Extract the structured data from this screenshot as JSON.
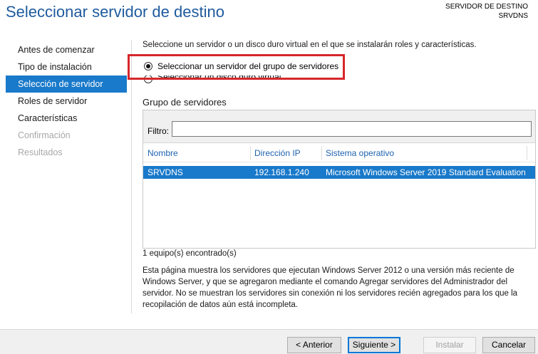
{
  "header": {
    "title": "Seleccionar servidor de destino",
    "dest_label": "SERVIDOR DE DESTINO",
    "dest_server": "SRVDNS"
  },
  "nav": {
    "items": [
      {
        "label": "Antes de comenzar",
        "state": "normal"
      },
      {
        "label": "Tipo de instalación",
        "state": "normal"
      },
      {
        "label": "Selección de servidor",
        "state": "active"
      },
      {
        "label": "Roles de servidor",
        "state": "normal"
      },
      {
        "label": "Características",
        "state": "normal"
      },
      {
        "label": "Confirmación",
        "state": "disabled"
      },
      {
        "label": "Resultados",
        "state": "disabled"
      }
    ]
  },
  "main": {
    "intro": "Seleccione un servidor o un disco duro virtual en el que se instalarán roles y características.",
    "option_pool": "Seleccionar un servidor del grupo de servidores",
    "option_vhd": "Seleccionar un disco duro virtual",
    "group_title": "Grupo de servidores",
    "filter_label": "Filtro:",
    "filter_value": "",
    "columns": [
      "Nombre",
      "Dirección IP",
      "Sistema operativo"
    ],
    "rows": [
      {
        "name": "SRVDNS",
        "ip": "192.168.1.240",
        "os": "Microsoft Windows Server 2019 Standard Evaluation"
      }
    ],
    "count": "1 equipo(s) encontrado(s)",
    "description": "Esta página muestra los servidores que ejecutan Windows Server 2012 o una versión más reciente de Windows Server, y que se agregaron mediante el comando Agregar servidores del Administrador del servidor. No se muestran los servidores sin conexión ni los servidores recién agregados para los que la recopilación de datos aún está incompleta."
  },
  "footer": {
    "prev": "< Anterior",
    "next": "Siguiente >",
    "install": "Instalar",
    "cancel": "Cancelar"
  },
  "colors": {
    "accent": "#1979ca",
    "title": "#1e5b9e",
    "highlight": "#d6262b"
  }
}
